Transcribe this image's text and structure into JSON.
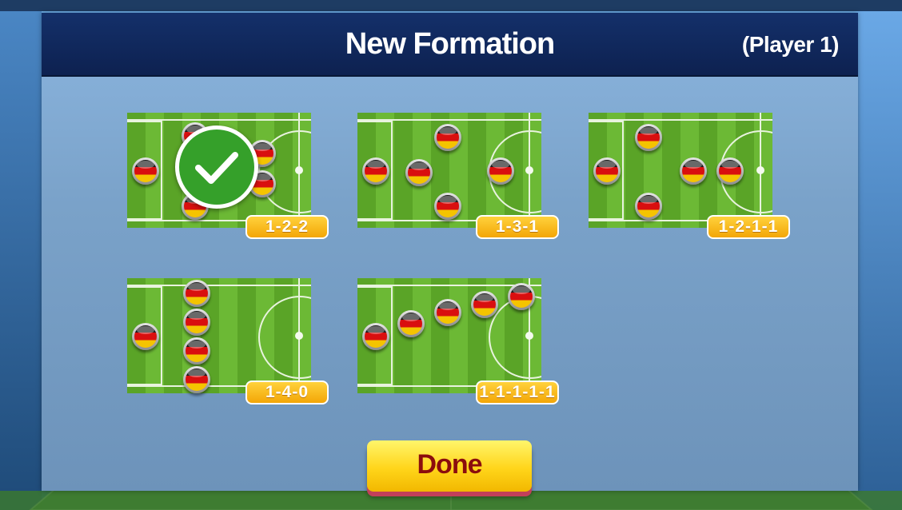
{
  "header": {
    "title": "New Formation",
    "player": "(Player 1)"
  },
  "formations": [
    {
      "label": "1-2-2",
      "selected": true
    },
    {
      "label": "1-3-1",
      "selected": false
    },
    {
      "label": "1-2-1-1",
      "selected": false
    },
    {
      "label": "1-4-0",
      "selected": false
    },
    {
      "label": "1-1-1-1-1",
      "selected": false
    }
  ],
  "done_label": "Done",
  "icons": {
    "checkmark": "check-icon",
    "player_token": "germany-flag-puck-icon"
  },
  "colors": {
    "header": "#0d2150",
    "badge": "#f3a607",
    "done_text": "#8b0d0d",
    "check": "#35a02a"
  }
}
